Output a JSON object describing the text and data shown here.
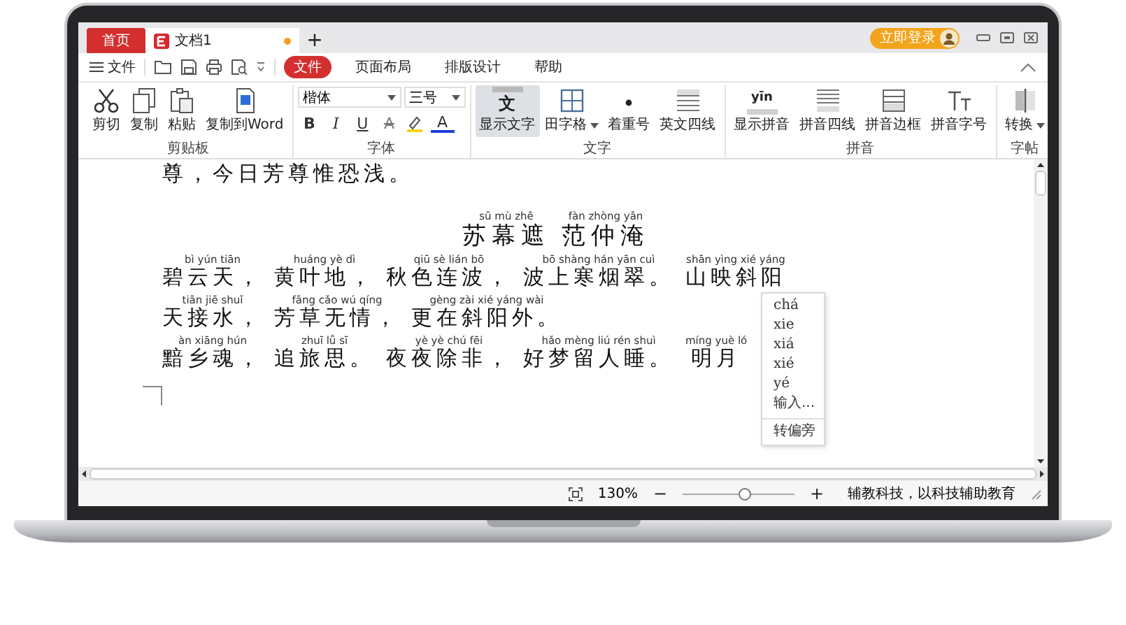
{
  "title_bar": {
    "tabs": [
      {
        "label": "首页",
        "kind": "home",
        "selected": false,
        "modified": false
      },
      {
        "label": "文档1",
        "kind": "document",
        "selected": true,
        "modified": true
      }
    ],
    "new_tab": "+",
    "login_button": "立即登录"
  },
  "menu_bar": {
    "file_menu": "文件",
    "tabs": [
      {
        "label": "文件",
        "selected": true
      },
      {
        "label": "页面布局",
        "selected": false
      },
      {
        "label": "排版设计",
        "selected": false
      },
      {
        "label": "帮助",
        "selected": false
      }
    ]
  },
  "ribbon": {
    "groups": [
      {
        "label": "剪贴板",
        "kind": "buttons",
        "buttons": [
          {
            "label": "剪切",
            "kind": "cut",
            "selected": false,
            "dropdown": false
          },
          {
            "label": "复制",
            "kind": "copy",
            "selected": false,
            "dropdown": false
          },
          {
            "label": "粘贴",
            "kind": "paste",
            "selected": false,
            "dropdown": false
          },
          {
            "label": "复制到Word",
            "kind": "to-word",
            "selected": false,
            "dropdown": false
          }
        ]
      },
      {
        "label": "字体",
        "kind": "font",
        "font": "楷体",
        "size": "三号",
        "buttons": [
          {
            "kind": "bold",
            "glyph": "B"
          },
          {
            "kind": "italic",
            "glyph": "I"
          },
          {
            "kind": "underline",
            "glyph": "U"
          },
          {
            "kind": "strike",
            "glyph": "A"
          },
          {
            "kind": "highlight"
          },
          {
            "kind": "color",
            "glyph": "A"
          }
        ]
      },
      {
        "label": "文字",
        "kind": "buttons",
        "buttons": [
          {
            "label": "显示文字",
            "kind": "show-text",
            "icon_text": "文",
            "selected": true,
            "dropdown": false
          },
          {
            "label": "田字格",
            "kind": "grid",
            "selected": false,
            "dropdown": true
          },
          {
            "label": "着重号",
            "kind": "emphasis",
            "selected": false,
            "dropdown": false
          },
          {
            "label": "英文四线",
            "kind": "four-lines",
            "selected": false,
            "dropdown": false
          }
        ]
      },
      {
        "label": "拼音",
        "kind": "buttons",
        "buttons": [
          {
            "label": "显示拼音",
            "kind": "show-pinyin",
            "icon_text": "yīn",
            "selected": false,
            "dropdown": false
          },
          {
            "label": "拼音四线",
            "kind": "pinyin-lines",
            "selected": false,
            "dropdown": false
          },
          {
            "label": "拼音边框",
            "kind": "pinyin-border",
            "selected": false,
            "dropdown": false
          },
          {
            "label": "拼音字号",
            "kind": "pinyin-size",
            "selected": false,
            "dropdown": false
          }
        ]
      },
      {
        "label": "字帖",
        "kind": "buttons",
        "buttons": [
          {
            "label": "转换",
            "kind": "convert",
            "selected": false,
            "dropdown": true
          }
        ]
      }
    ]
  },
  "document": {
    "lines": [
      {
        "kind": "body",
        "segments": [
          {
            "text": "尊，今日芳尊惟恐浅。"
          }
        ]
      },
      {
        "kind": "title",
        "segments": [
          {
            "pinyin": "sū mù zhē",
            "text": "苏幕遮"
          },
          {
            "pinyin": "fàn zhòng yān",
            "text": "范仲淹"
          }
        ]
      },
      {
        "kind": "body",
        "segments": [
          {
            "pinyin": "bì yún tiān",
            "text": "碧云天，"
          },
          {
            "pinyin": "huáng yè dì",
            "text": "黄叶地，"
          },
          {
            "pinyin": "qiū sè lián bō",
            "text": "秋色连波，"
          },
          {
            "pinyin": "bō shàng hán yān cuì",
            "text": "波上寒烟翠。"
          },
          {
            "pinyin": "shān yìng xié yáng",
            "text": "山映斜阳"
          }
        ]
      },
      {
        "kind": "body",
        "segments": [
          {
            "pinyin": "tiān jiē shuǐ",
            "text": "天接水，"
          },
          {
            "pinyin": "fāng cǎo wú qíng",
            "text": "芳草无情，"
          },
          {
            "pinyin": "gèng zài xié yáng wài",
            "text": "更在斜阳外。"
          }
        ]
      },
      {
        "kind": "body",
        "segments": [
          {
            "pinyin": "àn xiāng hún",
            "text": "黯乡魂，"
          },
          {
            "pinyin": "zhuī lǚ sī",
            "text": "追旅思。"
          },
          {
            "pinyin": "yè yè chú fēi",
            "text": "夜夜除非，"
          },
          {
            "pinyin": "hǎo mèng liú rén shuì",
            "text": "好梦留人睡。"
          },
          {
            "pinyin": "míng yuè ló",
            "text": "明月"
          }
        ]
      }
    ]
  },
  "context_menu": {
    "items": [
      {
        "label": "chá",
        "kind": "reading"
      },
      {
        "label": "xie",
        "kind": "reading"
      },
      {
        "label": "xiá",
        "kind": "reading"
      },
      {
        "label": "xié",
        "kind": "reading"
      },
      {
        "label": "yé",
        "kind": "reading"
      },
      {
        "label": "输入...",
        "kind": "input"
      },
      {
        "label": "转偏旁",
        "kind": "command"
      }
    ]
  },
  "status_bar": {
    "zoom": "130%",
    "zoom_minus": "−",
    "zoom_plus": "+",
    "zoom_slider": {
      "level": 0.55
    },
    "slogan": "辅教科技，以科技辅助教育"
  }
}
